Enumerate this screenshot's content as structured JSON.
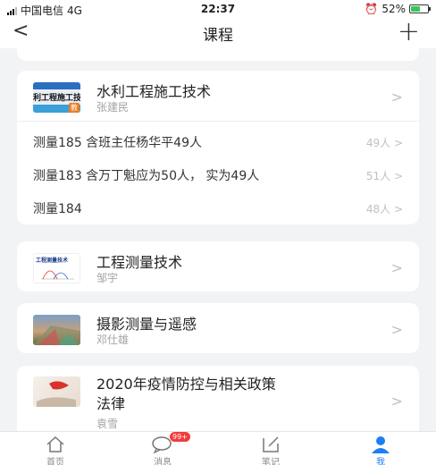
{
  "status_bar": {
    "carrier": "中国电信",
    "network": "4G",
    "time": "22:37",
    "battery": "52%"
  },
  "nav": {
    "back_glyph": "<",
    "title": "课程",
    "add_glyph": "+"
  },
  "courses": [
    {
      "name": "水利工程施工技术",
      "teacher": "张建民",
      "thumb_text": "利工程施工技术",
      "thumb_badge": "教",
      "classes": [
        {
          "name": "测量185 含班主任杨华平49人",
          "count": "49人"
        },
        {
          "name": "测量183 含万丁魁应为50人， 实为49人",
          "count": "51人"
        },
        {
          "name": "测量184",
          "count": "48人"
        }
      ]
    },
    {
      "name": "工程测量技术",
      "teacher": "邹宇",
      "thumb_text": "工程测量技术"
    },
    {
      "name": "摄影测量与遥感",
      "teacher": "邓仕雄"
    },
    {
      "name_line1": "2020年疫情防控与相关政策",
      "name_line2": "法律",
      "teacher": "袁雪"
    }
  ],
  "chevron": ">",
  "tabs": [
    {
      "label": "首页",
      "icon": "home-icon"
    },
    {
      "label": "消息",
      "icon": "chat-icon",
      "badge": "99+"
    },
    {
      "label": "笔记",
      "icon": "note-icon"
    },
    {
      "label": "我",
      "icon": "person-icon",
      "active": true
    }
  ],
  "colors": {
    "accent": "#1e7ef5",
    "badge": "#f23b3b",
    "background": "#f2f3f5"
  }
}
